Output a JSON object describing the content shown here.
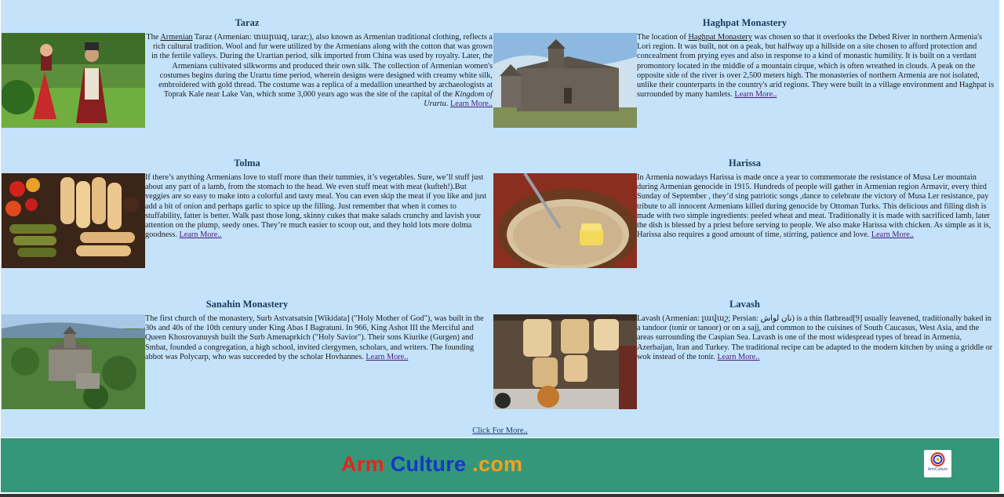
{
  "cards": [
    {
      "title": "Taraz",
      "text_pre": "The ",
      "text_link_inline": "Armenian",
      "text_mid": " Taraz (Armenian: տարազ, taraz;), also known as Armenian traditional clothing, reflects a rich cultural tradition. Wool and fur were utilized by the Armenians along with the cotton that was grown in the fertile valleys. During the Urartian period, silk imported from China was used by royalty. Later, the Armenians cultivated silkworms and produced their own silk. The collection of Armenian women's costumes begins during the Urartu time period, wherein designs were designed with creamy white silk, embroidered with gold thread. The costume was a replica of a medallion unearthed by archaeologists at Toprak Kale near Lake Van, which some 3,000 years ago was the site of the capital of the ",
      "text_italic": "Kingdom of Urartu",
      "text_post": ". ",
      "learn_more": "Learn More.."
    },
    {
      "title": "Haghpat Monastery",
      "text_pre": "The location of ",
      "text_link_inline": "Haghpat Monastery",
      "text_mid": " was chosen so that it overlooks the Debed River in northern Armenia's Lori region. It was built, not on a peak, but halfway up a hillside on a site chosen to afford protection and concealment from prying eyes and also in response to a kind of monastic humility. It is built on a verdant promontory located in the middle of a mountain cirque, which is often wreathed in clouds. A peak on the opposite side of the river is over 2,500 meters high. The monasteries of northern Armenia are not isolated, unlike their counterparts in the country's arid regions. They were built in a village environment and Haghpat is surrounded by many hamlets. ",
      "learn_more": "Learn More.."
    },
    {
      "title": "Tolma",
      "text": "If there’s anything Armenians love to stuff more than their tummies, it’s vegetables. Sure, we’ll stuff just about any part of a lamb, from the stomach to the head. We even stuff meat with meat (kufteh!).But veggies are so easy to make into a colorful and tasty meal. You can even skip the meat if you like and just add a bit of onion and perhaps garlic to spice up the filling. Just remember that when it comes to stuffability, fatter is better. Walk past those long, skinny cukes that make salads crunchy and lavish your attention on the plump, seedy ones. They’re much easier to scoop out, and they hold lots more dolma goodness. ",
      "learn_more": "Learn More.."
    },
    {
      "title": "Harissa",
      "text": "In Armenia nowadays Harissa is made once a year to commemorate the resistance of Musa Ler mountain during Armenian genocide in 1915. Hundreds of people will gather in Armenian region Armavir, every third Sunday of September , they’d sing patriotic songs ,dance to celebrate the victory of Musa Ler resistance, pay tribute to all innocent Armenians killed during genocide by Ottoman Turks. This delicious and filling dish is made with two simple ingredients: peeled wheat and meat. Traditionally it is made with sacrificed lamb, later the dish is blessed by a priest before serving to people. We also make Harissa with chicken. As simple as it is, Harissa also requires a good amount of time, stirring, patience and love. ",
      "learn_more": "Learn More.."
    },
    {
      "title": "Sanahin Monastery",
      "text": "The first church of the monastery, Surb Astvatsatsin [Wikidata] (\"Holy Mother of God\"), was built in the 30s and 40s of the 10th century under King Abas I Bagratuni. In 966, King Ashot III the Merciful and Queen Khosrovanuysh built the Surb Amenaprkich (\"Holy Savior\"). Their sons Kiurike (Gurgen) and Smbat, founded a congregation, a high school, invited clergymen, scholars, and writers. The founding abbot was Polycarp, who was succeeded by the scholar Hovhannes. ",
      "learn_more": "Learn More.."
    },
    {
      "title": "Lavash",
      "text": "Lavash (Armenian: լավաշ; Persian: نان لواش) is a thin flatbread[9] usually leavened, traditionally baked in a tandoor (tonir or tanoor) or on a sajj, and common to the cuisines of South Caucasus, West Asia, and the areas surrounding the Caspian Sea. Lavash is one of the most widespread types of bread in Armenia, Azerbaijan, Iran and Turkey. The traditional recipe can be adapted to the modern kitchen by using a griddle or wok instead of the tonir. ",
      "learn_more": "Learn More.."
    }
  ],
  "click_more": "Click For More..",
  "footer": {
    "brand_part1": "Arm",
    "brand_part2": "Culture",
    "brand_part3": " .com",
    "logo_text": "ArmCulture"
  },
  "colors": {
    "page_bg": "#c4e3fb",
    "footer_bg": "#359779",
    "brand_red": "#e3261b",
    "brand_blue": "#1438c8",
    "brand_orange": "#f5a21a"
  }
}
